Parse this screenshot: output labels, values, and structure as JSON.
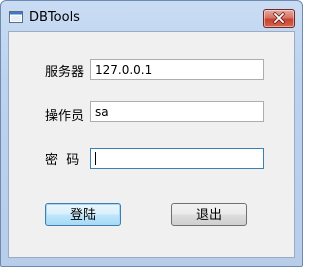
{
  "window": {
    "title": "DBTools",
    "close_icon": "close-icon"
  },
  "form": {
    "server_label": "服务器",
    "server_value": "127.0.0.1",
    "operator_label": "操作员",
    "operator_value": "sa",
    "password_label": "密  码",
    "password_value": ""
  },
  "buttons": {
    "login_label": "登陆",
    "exit_label": "退出"
  },
  "colors": {
    "titlebar": "#bcd2ee",
    "close_button": "#c7432f",
    "default_button_border": "#3c7fb1"
  }
}
